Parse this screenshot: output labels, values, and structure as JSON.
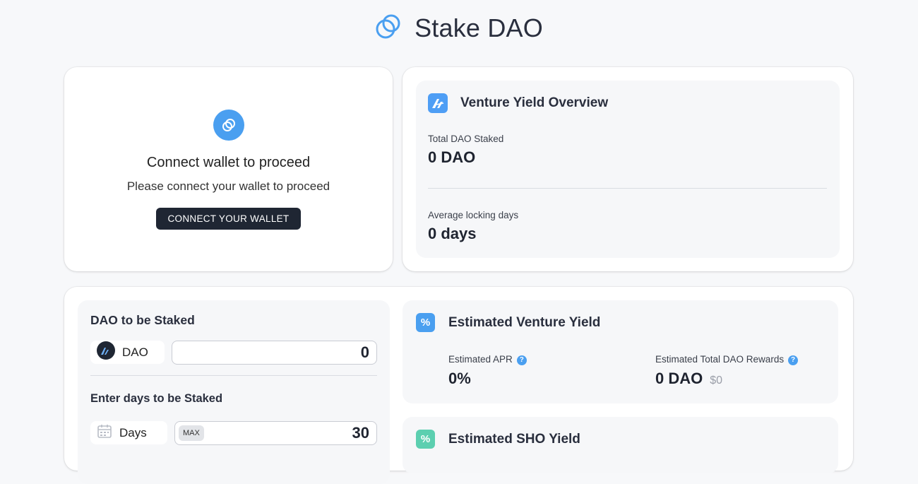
{
  "header": {
    "title": "Stake DAO",
    "logo_icon": "stake-dao-logo-icon",
    "accent": "#4a9ff0"
  },
  "connect": {
    "icon": "wallet-link-icon",
    "title": "Connect wallet to proceed",
    "subtitle": "Please connect your wallet to proceed",
    "button_label": "CONNECT YOUR WALLET"
  },
  "overview": {
    "title": "Venture Yield Overview",
    "total_label": "Total DAO Staked",
    "total_value": "0 DAO",
    "avg_label": "Average locking days",
    "avg_value": "0 days"
  },
  "stake": {
    "title": "DAO to be Staked",
    "token_label": "DAO",
    "amount_value": "0",
    "days_title": "Enter days to be Staked",
    "days_label": "Days",
    "max_label": "MAX",
    "days_value": "30"
  },
  "venture_yield": {
    "badge": "%",
    "title": "Estimated Venture Yield",
    "apr_label": "Estimated APR",
    "apr_value": "0%",
    "rewards_label": "Estimated Total DAO Rewards",
    "rewards_value": "0 DAO",
    "rewards_usd": "$0",
    "help": "?"
  },
  "sho_yield": {
    "badge": "%",
    "title": "Estimated SHO Yield",
    "badge_color": "#5ccfb0"
  }
}
